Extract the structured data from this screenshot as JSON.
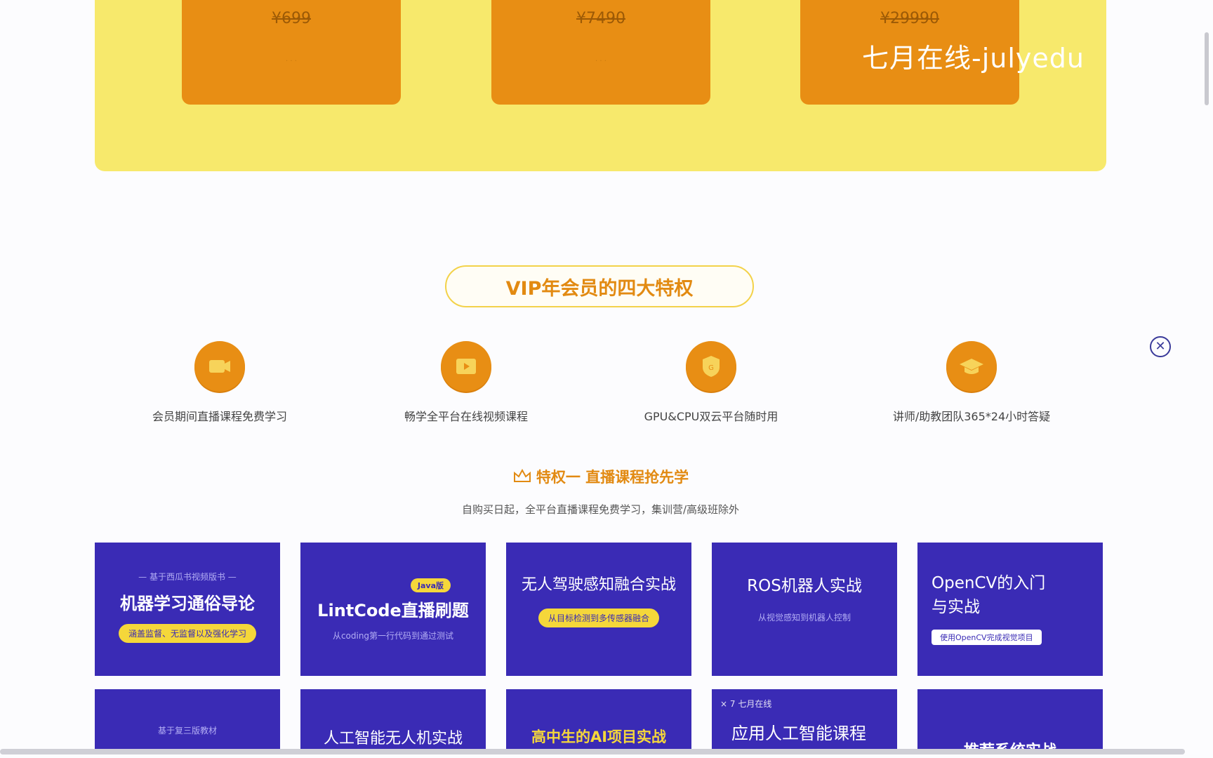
{
  "pricing": {
    "cards": [
      {
        "price": "¥699"
      },
      {
        "price": "¥7490"
      },
      {
        "price": "¥29990"
      }
    ],
    "watermark": "七月在线-julyedu"
  },
  "vip": {
    "title": "VIP年会员的四大特权",
    "features": [
      {
        "label": "会员期间直播课程免费学习",
        "icon": "live-icon"
      },
      {
        "label": "畅学全平台在线视频课程",
        "icon": "video-icon"
      },
      {
        "label": "GPU&CPU双云平台随时用",
        "icon": "gpu-icon"
      },
      {
        "label": "讲师/助教团队365*24小时答疑",
        "icon": "graduation-cap-icon"
      }
    ]
  },
  "privilege": {
    "title": "特权一 直播课程抢先学",
    "subtitle": "自购买日起，全平台直播课程免费学习，集训营/高级班除外"
  },
  "courses": {
    "row1": [
      {
        "small": "— 基于西瓜书视频版书 —",
        "title": "机器学习通俗导论",
        "chip": "涵盖监督、无监督以及强化学习"
      },
      {
        "tag": "Java版",
        "title": "LintCode直播刷题",
        "small": "从coding第一行代码到通过测试"
      },
      {
        "title": "无人驾驶感知融合实战",
        "chip": "从目标检测到多传感器融合"
      },
      {
        "title": "ROS机器人实战",
        "small": "从视觉感知到机器人控制"
      },
      {
        "title_line1": "OpenCV的入门",
        "title_line2": "与实战",
        "chip": "使用OpenCV完成视觉项目"
      }
    ],
    "row2": [
      {
        "small": "基于复三版教材"
      },
      {
        "title": "人工智能无人机实战"
      },
      {
        "title": "高中生的AI项目实战"
      },
      {
        "brand": "×  7 七月在线",
        "title": "应用人工智能课程"
      },
      {
        "title": "推荐系统实战"
      }
    ]
  },
  "colors": {
    "accent": "#e88e14",
    "panel": "#f7e96c",
    "course_bg": "#3a2bb5"
  }
}
